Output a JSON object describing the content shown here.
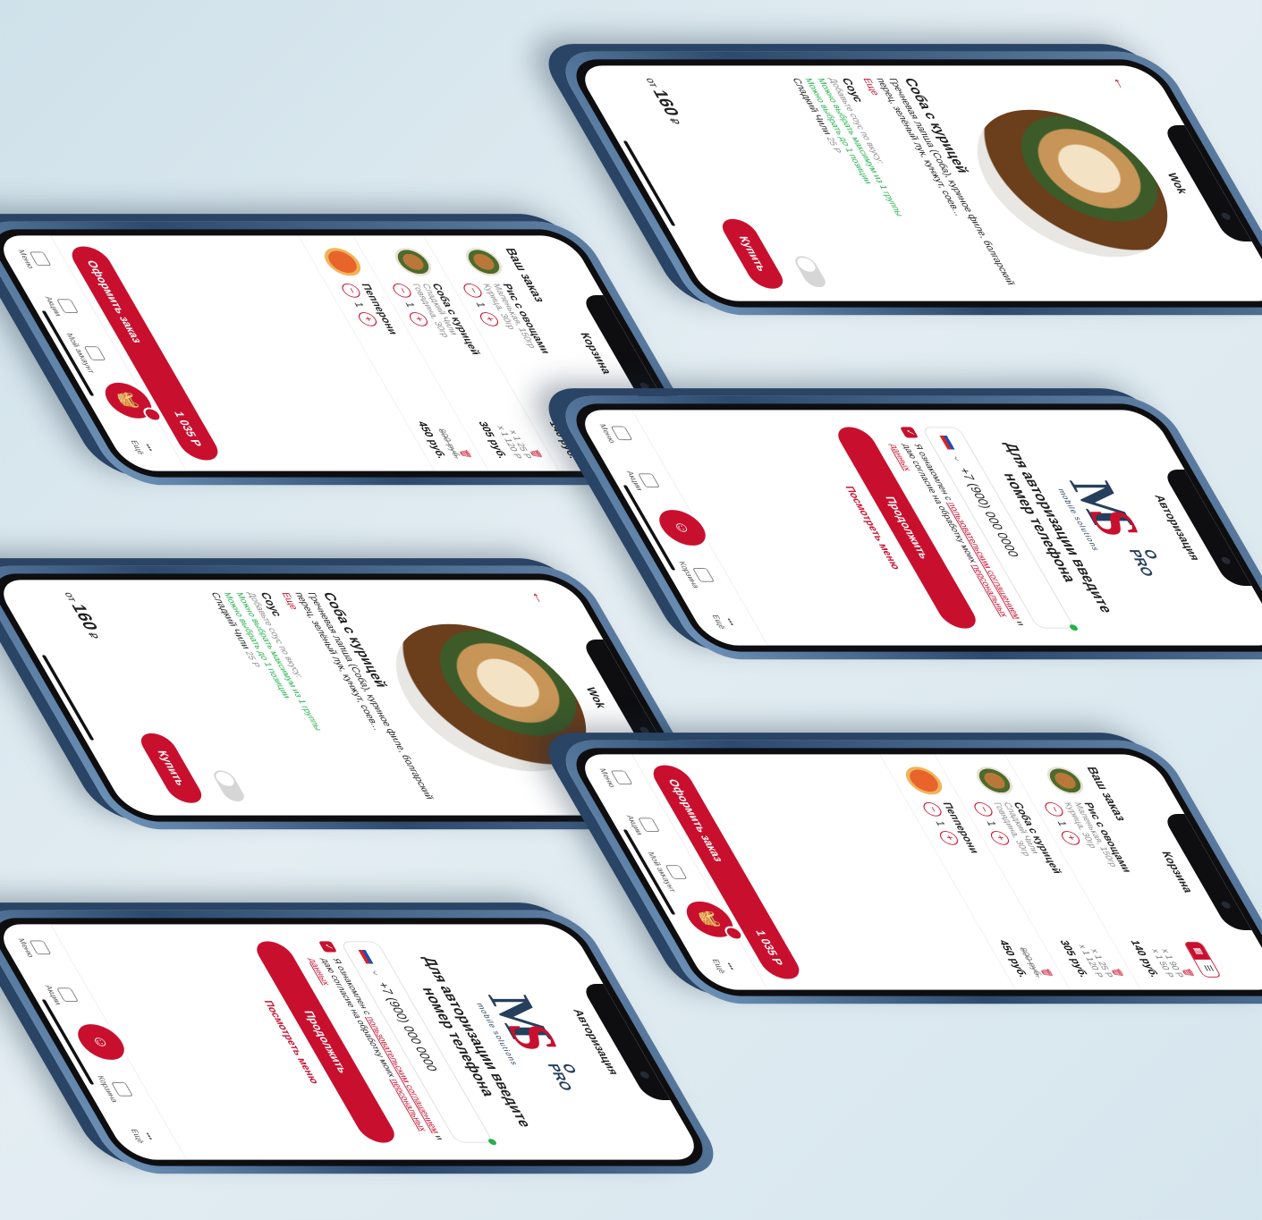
{
  "colors": {
    "accent": "#c8102e",
    "success": "#22b14c",
    "text": "#1f1f1f",
    "background": "#dbe8ef"
  },
  "product": {
    "title": "Wok",
    "back_icon": "arrow-left-icon",
    "name": "Соба с курицей",
    "description": "Гречневая лапша (Соба), куриное филе, болгарский перец, зелёный лук, кунжут, соев...",
    "more": "Еще",
    "sauce_title": "Соус",
    "sauce_hint": "Добавьте соус по вкусу:",
    "rule_max_group": "Можно выбрать максимум из 1 группы",
    "rule_max_position": "Можно выбрать до 1 позиции",
    "sauce_option": "Сладкий Чили",
    "sauce_option_price": "25 Р",
    "price_prefix": "от",
    "price": "160",
    "currency": "₽",
    "buy": "Купить"
  },
  "auth": {
    "title": "Авторизация",
    "logo_sub": "mobile solutions",
    "heading": "Для авторизации введите номер телефона",
    "country_code": "+7",
    "phone_value": "(900) 000 0000",
    "phone_value_short": "(900) 000 0000",
    "agree_prefix": "Я ознакомлен с",
    "agree_link1": "пользовательским соглашением",
    "agree_mid": "и даю согласие на обработку моих",
    "agree_link2": "персональных данных",
    "continue": "Продолжить",
    "view_menu": "Посмотреть меню"
  },
  "cart": {
    "title": "Корзина",
    "section": "Ваш заказ",
    "items": [
      {
        "name": "Рис с овощами",
        "opts": "Маленькая, 150гр",
        "opts2": "Курица, 30гр",
        "qty": "1",
        "line1": "x 1   90 Р",
        "line2": "x 1   50 Р",
        "total": "140 руб."
      },
      {
        "name": "Соба с курицей",
        "opts": "Сладкий Чили",
        "opts2": "Говядина, 30гр",
        "qty": "1",
        "line1": "x 1   25 Р",
        "line2": "x 1   120 Р",
        "total": "305 руб."
      },
      {
        "name": "Пепперони",
        "opts": "",
        "opts2": "",
        "qty": "1",
        "line1": "",
        "line2": "",
        "old": "800 руб.",
        "total": "450 руб."
      }
    ],
    "order_button": "Оформить заказ",
    "order_total": "1 035 Р"
  },
  "tabbar": {
    "menu": "Меню",
    "promo": "Акции",
    "account": "Мой аккаунт",
    "cart": "Корзина",
    "more": "Ещё"
  }
}
